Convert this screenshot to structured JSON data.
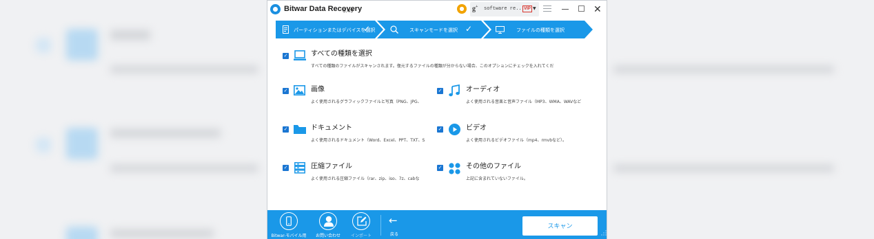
{
  "window": {
    "app_title": "Bitwar Data Recovery",
    "version": "6.49",
    "account_name": "software re...",
    "vip_label": "VIP"
  },
  "wizard": {
    "steps": [
      {
        "label": "パーティションまたはデバイスを選択",
        "done": true
      },
      {
        "label": "スキャンモードを選択",
        "done": true
      },
      {
        "label": "ファイルの種類を選択",
        "done": false
      }
    ]
  },
  "categories": {
    "all": {
      "title": "すべての種類を選択",
      "desc": "すべての種類のファイルがスキャンされます。復元するファイルの種類が分からない場合、このオプションにチェックを入れてくだ",
      "checked": true
    },
    "images": {
      "title": "画像",
      "desc": "よく使用されるグラフィックファイルと写真（PNG、JPG、",
      "checked": true
    },
    "audio": {
      "title": "オーディオ",
      "desc": "よく使用される音楽と音声ファイル（MP3、WMA、WAVなど",
      "checked": true
    },
    "documents": {
      "title": "ドキュメント",
      "desc": "よく使用されるドキュメント（Word、Excel、PPT、TXT、S",
      "checked": true
    },
    "video": {
      "title": "ビデオ",
      "desc": "よく使用されるビデオファイル（mp4、rmvbなど）。",
      "checked": true
    },
    "archives": {
      "title": "圧縮ファイル",
      "desc": "よく使用される圧縮ファイル（rar、zip、iso、7z、cabな",
      "checked": true
    },
    "other": {
      "title": "その他のファイル",
      "desc": "上記に含まれていないファイル。",
      "checked": true
    }
  },
  "toolbar": {
    "mobile_label": "Bitwar-モバイル用",
    "contact_label": "お問い合わせ",
    "import_label": "インポート",
    "back_label": "戻る",
    "scan_label": "スキャン"
  },
  "colors": {
    "accent": "#1a98e8",
    "checkbox": "#1a76d2"
  }
}
